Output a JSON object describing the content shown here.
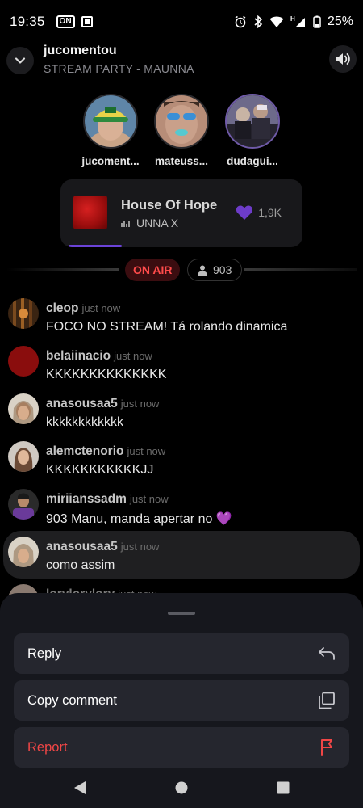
{
  "status_bar": {
    "time": "19:35",
    "battery": "25%"
  },
  "header": {
    "title": "jucomentou",
    "subtitle": "STREAM PARTY - MAUNNA"
  },
  "participants": [
    {
      "name": "jucoment..."
    },
    {
      "name": "mateuss..."
    },
    {
      "name": "dudagui..."
    }
  ],
  "now_playing": {
    "title": "House Of Hope",
    "artist": "UNNA X",
    "likes": "1,9K",
    "progress_fraction": 0.22
  },
  "live": {
    "on_air_label": "ON AIR",
    "viewers": "903"
  },
  "chat": [
    {
      "user": "cleop",
      "time": "just now",
      "text": "FOCO NO STREAM! Tá rolando dinamica"
    },
    {
      "user": "belaiinacio",
      "time": "just now",
      "text": "KKKKKKKKKKKKKK"
    },
    {
      "user": "anasousaa5",
      "time": "just now",
      "text": "kkkkkkkkkkkk"
    },
    {
      "user": "alemctenorio",
      "time": "just now",
      "text": "KKKKKKKKKKKJJ"
    },
    {
      "user": "miriianssadm",
      "time": "just now",
      "text": "903 Manu, manda apertar no 💜"
    },
    {
      "user": "anasousaa5",
      "time": "just now",
      "text": "como assim"
    },
    {
      "user": "lorylorylory",
      "time": "just now",
      "text": ""
    }
  ],
  "sheet": {
    "reply_label": "Reply",
    "copy_label": "Copy comment",
    "report_label": "Report"
  },
  "colors": {
    "accent_purple": "#6b43d8",
    "heart": "#6d3cc9",
    "on_air_red": "#ff4b4b",
    "report_red": "#f04646"
  }
}
